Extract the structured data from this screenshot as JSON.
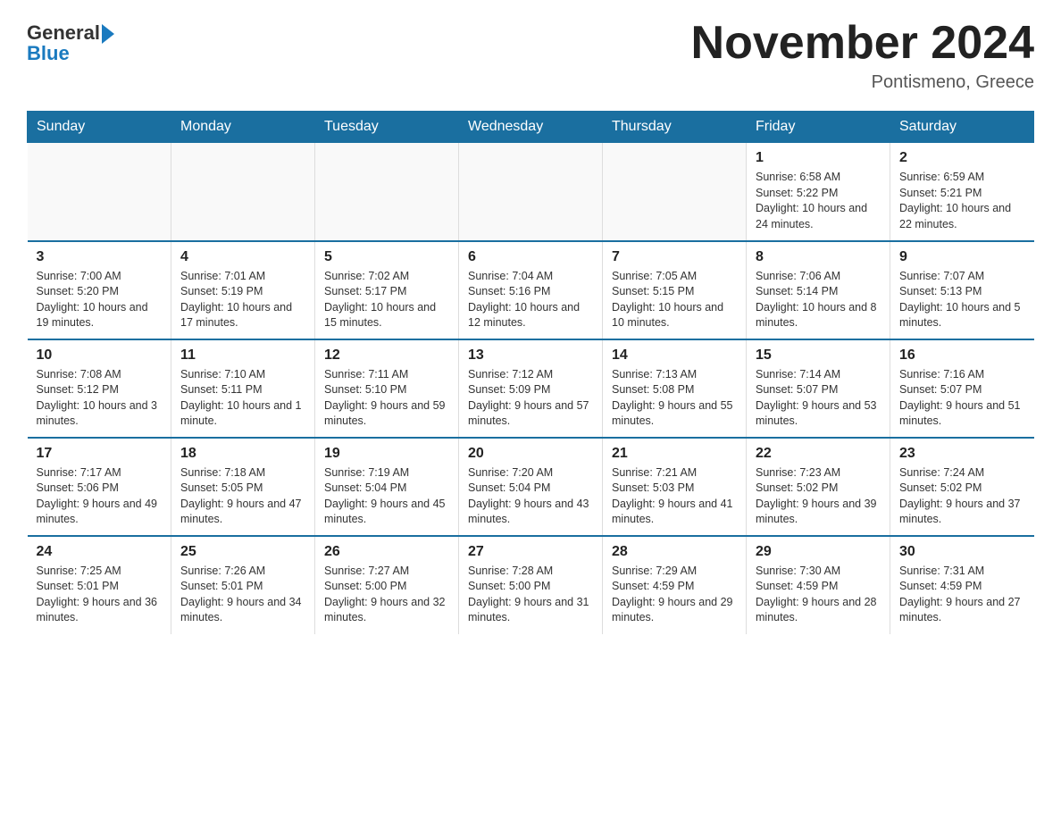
{
  "header": {
    "logo_general": "General",
    "logo_blue": "Blue",
    "month_title": "November 2024",
    "location": "Pontismeno, Greece"
  },
  "days_of_week": [
    "Sunday",
    "Monday",
    "Tuesday",
    "Wednesday",
    "Thursday",
    "Friday",
    "Saturday"
  ],
  "weeks": [
    [
      {
        "day": "",
        "info": ""
      },
      {
        "day": "",
        "info": ""
      },
      {
        "day": "",
        "info": ""
      },
      {
        "day": "",
        "info": ""
      },
      {
        "day": "",
        "info": ""
      },
      {
        "day": "1",
        "info": "Sunrise: 6:58 AM\nSunset: 5:22 PM\nDaylight: 10 hours and 24 minutes."
      },
      {
        "day": "2",
        "info": "Sunrise: 6:59 AM\nSunset: 5:21 PM\nDaylight: 10 hours and 22 minutes."
      }
    ],
    [
      {
        "day": "3",
        "info": "Sunrise: 7:00 AM\nSunset: 5:20 PM\nDaylight: 10 hours and 19 minutes."
      },
      {
        "day": "4",
        "info": "Sunrise: 7:01 AM\nSunset: 5:19 PM\nDaylight: 10 hours and 17 minutes."
      },
      {
        "day": "5",
        "info": "Sunrise: 7:02 AM\nSunset: 5:17 PM\nDaylight: 10 hours and 15 minutes."
      },
      {
        "day": "6",
        "info": "Sunrise: 7:04 AM\nSunset: 5:16 PM\nDaylight: 10 hours and 12 minutes."
      },
      {
        "day": "7",
        "info": "Sunrise: 7:05 AM\nSunset: 5:15 PM\nDaylight: 10 hours and 10 minutes."
      },
      {
        "day": "8",
        "info": "Sunrise: 7:06 AM\nSunset: 5:14 PM\nDaylight: 10 hours and 8 minutes."
      },
      {
        "day": "9",
        "info": "Sunrise: 7:07 AM\nSunset: 5:13 PM\nDaylight: 10 hours and 5 minutes."
      }
    ],
    [
      {
        "day": "10",
        "info": "Sunrise: 7:08 AM\nSunset: 5:12 PM\nDaylight: 10 hours and 3 minutes."
      },
      {
        "day": "11",
        "info": "Sunrise: 7:10 AM\nSunset: 5:11 PM\nDaylight: 10 hours and 1 minute."
      },
      {
        "day": "12",
        "info": "Sunrise: 7:11 AM\nSunset: 5:10 PM\nDaylight: 9 hours and 59 minutes."
      },
      {
        "day": "13",
        "info": "Sunrise: 7:12 AM\nSunset: 5:09 PM\nDaylight: 9 hours and 57 minutes."
      },
      {
        "day": "14",
        "info": "Sunrise: 7:13 AM\nSunset: 5:08 PM\nDaylight: 9 hours and 55 minutes."
      },
      {
        "day": "15",
        "info": "Sunrise: 7:14 AM\nSunset: 5:07 PM\nDaylight: 9 hours and 53 minutes."
      },
      {
        "day": "16",
        "info": "Sunrise: 7:16 AM\nSunset: 5:07 PM\nDaylight: 9 hours and 51 minutes."
      }
    ],
    [
      {
        "day": "17",
        "info": "Sunrise: 7:17 AM\nSunset: 5:06 PM\nDaylight: 9 hours and 49 minutes."
      },
      {
        "day": "18",
        "info": "Sunrise: 7:18 AM\nSunset: 5:05 PM\nDaylight: 9 hours and 47 minutes."
      },
      {
        "day": "19",
        "info": "Sunrise: 7:19 AM\nSunset: 5:04 PM\nDaylight: 9 hours and 45 minutes."
      },
      {
        "day": "20",
        "info": "Sunrise: 7:20 AM\nSunset: 5:04 PM\nDaylight: 9 hours and 43 minutes."
      },
      {
        "day": "21",
        "info": "Sunrise: 7:21 AM\nSunset: 5:03 PM\nDaylight: 9 hours and 41 minutes."
      },
      {
        "day": "22",
        "info": "Sunrise: 7:23 AM\nSunset: 5:02 PM\nDaylight: 9 hours and 39 minutes."
      },
      {
        "day": "23",
        "info": "Sunrise: 7:24 AM\nSunset: 5:02 PM\nDaylight: 9 hours and 37 minutes."
      }
    ],
    [
      {
        "day": "24",
        "info": "Sunrise: 7:25 AM\nSunset: 5:01 PM\nDaylight: 9 hours and 36 minutes."
      },
      {
        "day": "25",
        "info": "Sunrise: 7:26 AM\nSunset: 5:01 PM\nDaylight: 9 hours and 34 minutes."
      },
      {
        "day": "26",
        "info": "Sunrise: 7:27 AM\nSunset: 5:00 PM\nDaylight: 9 hours and 32 minutes."
      },
      {
        "day": "27",
        "info": "Sunrise: 7:28 AM\nSunset: 5:00 PM\nDaylight: 9 hours and 31 minutes."
      },
      {
        "day": "28",
        "info": "Sunrise: 7:29 AM\nSunset: 4:59 PM\nDaylight: 9 hours and 29 minutes."
      },
      {
        "day": "29",
        "info": "Sunrise: 7:30 AM\nSunset: 4:59 PM\nDaylight: 9 hours and 28 minutes."
      },
      {
        "day": "30",
        "info": "Sunrise: 7:31 AM\nSunset: 4:59 PM\nDaylight: 9 hours and 27 minutes."
      }
    ]
  ]
}
